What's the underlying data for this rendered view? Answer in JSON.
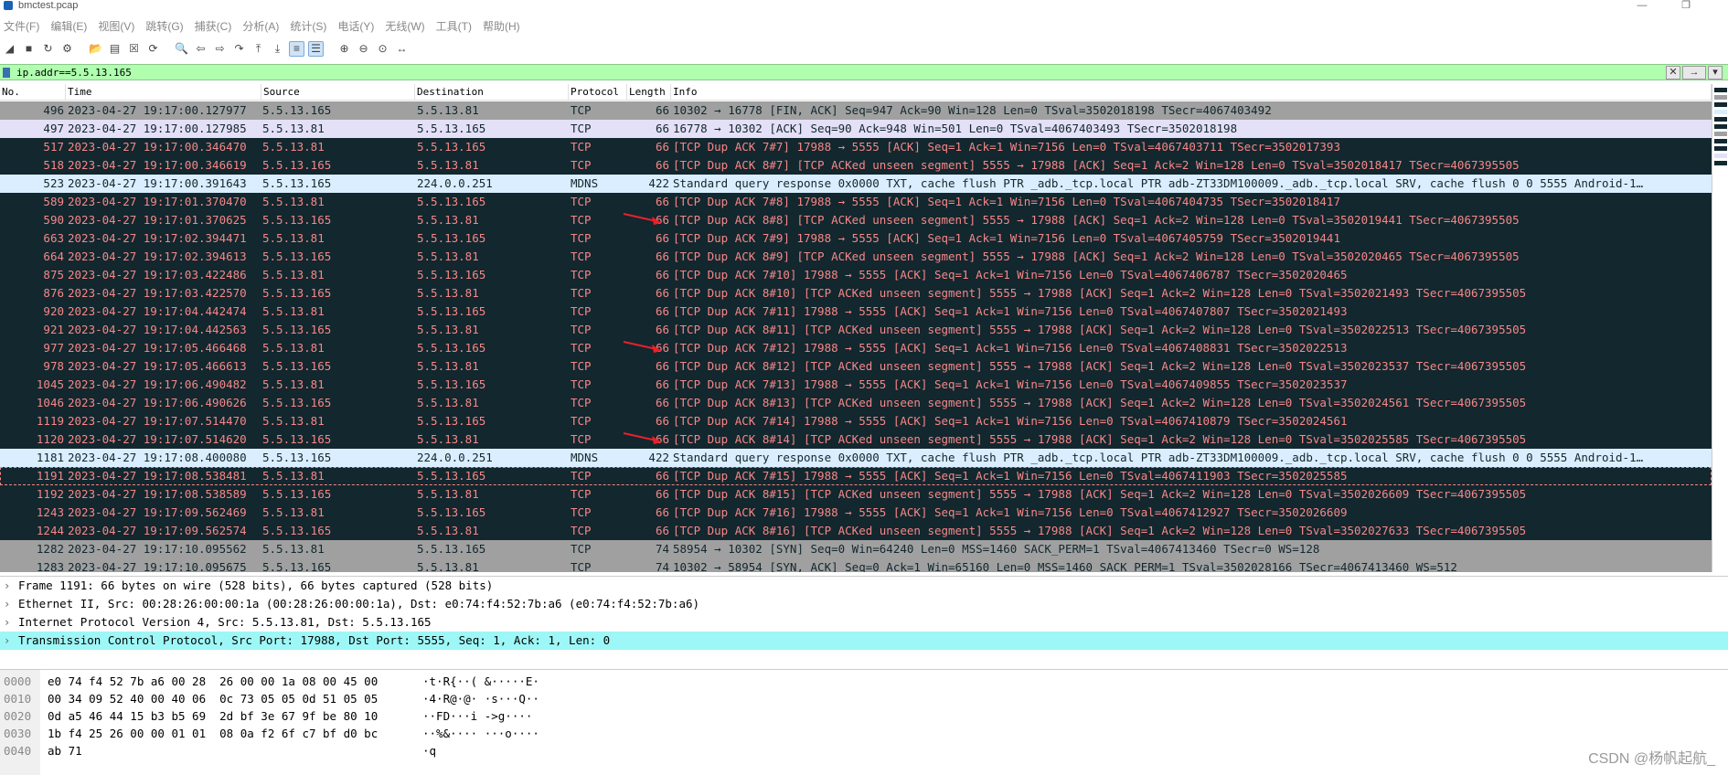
{
  "window": {
    "title": "bmctest.pcap",
    "minimize": "—",
    "restore": "❐"
  },
  "menu": [
    "文件(F)",
    "编辑(E)",
    "视图(V)",
    "跳转(G)",
    "捕获(C)",
    "分析(A)",
    "统计(S)",
    "电话(Y)",
    "无线(W)",
    "工具(T)",
    "帮助(H)"
  ],
  "toolbar_icons": [
    {
      "name": "shark-fin-start-icon",
      "glyph": "◢"
    },
    {
      "name": "stop-capture-icon",
      "glyph": "■"
    },
    {
      "name": "restart-capture-icon",
      "glyph": "↻"
    },
    {
      "name": "capture-options-icon",
      "glyph": "⚙"
    },
    {
      "name": "sep",
      "glyph": ""
    },
    {
      "name": "open-file-icon",
      "glyph": "📂"
    },
    {
      "name": "save-file-icon",
      "glyph": "▤"
    },
    {
      "name": "close-file-icon",
      "glyph": "☒"
    },
    {
      "name": "reload-file-icon",
      "glyph": "⟳"
    },
    {
      "name": "sep",
      "glyph": ""
    },
    {
      "name": "find-packet-icon",
      "glyph": "🔍"
    },
    {
      "name": "go-back-icon",
      "glyph": "⇦"
    },
    {
      "name": "go-forward-icon",
      "glyph": "⇨"
    },
    {
      "name": "go-to-packet-icon",
      "glyph": "↷"
    },
    {
      "name": "go-first-icon",
      "glyph": "⤒"
    },
    {
      "name": "go-last-icon",
      "glyph": "⤓"
    },
    {
      "name": "auto-scroll-icon",
      "glyph": "≡"
    },
    {
      "name": "colorize-icon",
      "glyph": "☰"
    },
    {
      "name": "sep",
      "glyph": ""
    },
    {
      "name": "zoom-in-icon",
      "glyph": "⊕"
    },
    {
      "name": "zoom-out-icon",
      "glyph": "⊖"
    },
    {
      "name": "normal-size-icon",
      "glyph": "⊙"
    },
    {
      "name": "resize-columns-icon",
      "glyph": "↔"
    }
  ],
  "filter": {
    "value": "ip.addr==5.5.13.165",
    "clear_label": "✕",
    "apply_label": "→",
    "dropdown_label": "▾"
  },
  "columns": [
    "No.",
    "Time",
    "Source",
    "Destination",
    "Protocol",
    "Length",
    "Info"
  ],
  "packets": [
    {
      "no": "496",
      "time": "2023-04-27 19:17:00.127977",
      "src": "5.5.13.165",
      "dst": "5.5.13.81",
      "proto": "TCP",
      "len": "66",
      "info": "10302 → 16778 [FIN, ACK] Seq=947 Ack=90 Win=128 Len=0 TSval=3502018198 TSecr=4067403492",
      "style": "gray"
    },
    {
      "no": "497",
      "time": "2023-04-27 19:17:00.127985",
      "src": "5.5.13.81",
      "dst": "5.5.13.165",
      "proto": "TCP",
      "len": "66",
      "info": "16778 → 10302 [ACK] Seq=90 Ack=948 Win=501 Len=0 TSval=4067403493 TSecr=3502018198",
      "style": "lav"
    },
    {
      "no": "517",
      "time": "2023-04-27 19:17:00.346470",
      "src": "5.5.13.81",
      "dst": "5.5.13.165",
      "proto": "TCP",
      "len": "66",
      "info": "[TCP Dup ACK 7#7] 17988 → 5555 [ACK] Seq=1 Ack=1 Win=7156 Len=0 TSval=4067403711 TSecr=3502017393",
      "style": "dark"
    },
    {
      "no": "518",
      "time": "2023-04-27 19:17:00.346619",
      "src": "5.5.13.165",
      "dst": "5.5.13.81",
      "proto": "TCP",
      "len": "66",
      "info": "[TCP Dup ACK 8#7] [TCP ACKed unseen segment] 5555 → 17988 [ACK] Seq=1 Ack=2 Win=128 Len=0 TSval=3502018417 TSecr=4067395505",
      "style": "dark"
    },
    {
      "no": "523",
      "time": "2023-04-27 19:17:00.391643",
      "src": "5.5.13.165",
      "dst": "224.0.0.251",
      "proto": "MDNS",
      "len": "422",
      "info": "Standard query response 0x0000 TXT, cache flush PTR _adb._tcp.local PTR adb-ZT33DM100009._adb._tcp.local SRV, cache flush 0 0 5555 Android-1…",
      "style": "light"
    },
    {
      "no": "589",
      "time": "2023-04-27 19:17:01.370470",
      "src": "5.5.13.81",
      "dst": "5.5.13.165",
      "proto": "TCP",
      "len": "66",
      "info": "[TCP Dup ACK 7#8] 17988 → 5555 [ACK] Seq=1 Ack=1 Win=7156 Len=0 TSval=4067404735 TSecr=3502018417",
      "style": "dark"
    },
    {
      "no": "590",
      "time": "2023-04-27 19:17:01.370625",
      "src": "5.5.13.165",
      "dst": "5.5.13.81",
      "proto": "TCP",
      "len": "66",
      "info": "[TCP Dup ACK 8#8] [TCP ACKed unseen segment] 5555 → 17988 [ACK] Seq=1 Ack=2 Win=128 Len=0 TSval=3502019441 TSecr=4067395505",
      "style": "dark"
    },
    {
      "no": "663",
      "time": "2023-04-27 19:17:02.394471",
      "src": "5.5.13.81",
      "dst": "5.5.13.165",
      "proto": "TCP",
      "len": "66",
      "info": "[TCP Dup ACK 7#9] 17988 → 5555 [ACK] Seq=1 Ack=1 Win=7156 Len=0 TSval=4067405759 TSecr=3502019441",
      "style": "dark"
    },
    {
      "no": "664",
      "time": "2023-04-27 19:17:02.394613",
      "src": "5.5.13.165",
      "dst": "5.5.13.81",
      "proto": "TCP",
      "len": "66",
      "info": "[TCP Dup ACK 8#9] [TCP ACKed unseen segment] 5555 → 17988 [ACK] Seq=1 Ack=2 Win=128 Len=0 TSval=3502020465 TSecr=4067395505",
      "style": "dark"
    },
    {
      "no": "875",
      "time": "2023-04-27 19:17:03.422486",
      "src": "5.5.13.81",
      "dst": "5.5.13.165",
      "proto": "TCP",
      "len": "66",
      "info": "[TCP Dup ACK 7#10] 17988 → 5555 [ACK] Seq=1 Ack=1 Win=7156 Len=0 TSval=4067406787 TSecr=3502020465",
      "style": "dark"
    },
    {
      "no": "876",
      "time": "2023-04-27 19:17:03.422570",
      "src": "5.5.13.165",
      "dst": "5.5.13.81",
      "proto": "TCP",
      "len": "66",
      "info": "[TCP Dup ACK 8#10] [TCP ACKed unseen segment] 5555 → 17988 [ACK] Seq=1 Ack=2 Win=128 Len=0 TSval=3502021493 TSecr=4067395505",
      "style": "dark"
    },
    {
      "no": "920",
      "time": "2023-04-27 19:17:04.442474",
      "src": "5.5.13.81",
      "dst": "5.5.13.165",
      "proto": "TCP",
      "len": "66",
      "info": "[TCP Dup ACK 7#11] 17988 → 5555 [ACK] Seq=1 Ack=1 Win=7156 Len=0 TSval=4067407807 TSecr=3502021493",
      "style": "dark"
    },
    {
      "no": "921",
      "time": "2023-04-27 19:17:04.442563",
      "src": "5.5.13.165",
      "dst": "5.5.13.81",
      "proto": "TCP",
      "len": "66",
      "info": "[TCP Dup ACK 8#11] [TCP ACKed unseen segment] 5555 → 17988 [ACK] Seq=1 Ack=2 Win=128 Len=0 TSval=3502022513 TSecr=4067395505",
      "style": "dark"
    },
    {
      "no": "977",
      "time": "2023-04-27 19:17:05.466468",
      "src": "5.5.13.81",
      "dst": "5.5.13.165",
      "proto": "TCP",
      "len": "66",
      "info": "[TCP Dup ACK 7#12] 17988 → 5555 [ACK] Seq=1 Ack=1 Win=7156 Len=0 TSval=4067408831 TSecr=3502022513",
      "style": "dark"
    },
    {
      "no": "978",
      "time": "2023-04-27 19:17:05.466613",
      "src": "5.5.13.165",
      "dst": "5.5.13.81",
      "proto": "TCP",
      "len": "66",
      "info": "[TCP Dup ACK 8#12] [TCP ACKed unseen segment] 5555 → 17988 [ACK] Seq=1 Ack=2 Win=128 Len=0 TSval=3502023537 TSecr=4067395505",
      "style": "dark"
    },
    {
      "no": "1045",
      "time": "2023-04-27 19:17:06.490482",
      "src": "5.5.13.81",
      "dst": "5.5.13.165",
      "proto": "TCP",
      "len": "66",
      "info": "[TCP Dup ACK 7#13] 17988 → 5555 [ACK] Seq=1 Ack=1 Win=7156 Len=0 TSval=4067409855 TSecr=3502023537",
      "style": "dark"
    },
    {
      "no": "1046",
      "time": "2023-04-27 19:17:06.490626",
      "src": "5.5.13.165",
      "dst": "5.5.13.81",
      "proto": "TCP",
      "len": "66",
      "info": "[TCP Dup ACK 8#13] [TCP ACKed unseen segment] 5555 → 17988 [ACK] Seq=1 Ack=2 Win=128 Len=0 TSval=3502024561 TSecr=4067395505",
      "style": "dark"
    },
    {
      "no": "1119",
      "time": "2023-04-27 19:17:07.514470",
      "src": "5.5.13.81",
      "dst": "5.5.13.165",
      "proto": "TCP",
      "len": "66",
      "info": "[TCP Dup ACK 7#14] 17988 → 5555 [ACK] Seq=1 Ack=1 Win=7156 Len=0 TSval=4067410879 TSecr=3502024561",
      "style": "dark"
    },
    {
      "no": "1120",
      "time": "2023-04-27 19:17:07.514620",
      "src": "5.5.13.165",
      "dst": "5.5.13.81",
      "proto": "TCP",
      "len": "66",
      "info": "[TCP Dup ACK 8#14] [TCP ACKed unseen segment] 5555 → 17988 [ACK] Seq=1 Ack=2 Win=128 Len=0 TSval=3502025585 TSecr=4067395505",
      "style": "dark"
    },
    {
      "no": "1181",
      "time": "2023-04-27 19:17:08.400080",
      "src": "5.5.13.165",
      "dst": "224.0.0.251",
      "proto": "MDNS",
      "len": "422",
      "info": "Standard query response 0x0000 TXT, cache flush PTR _adb._tcp.local PTR adb-ZT33DM100009._adb._tcp.local SRV, cache flush 0 0 5555 Android-1…",
      "style": "light"
    },
    {
      "no": "1191",
      "time": "2023-04-27 19:17:08.538481",
      "src": "5.5.13.81",
      "dst": "5.5.13.165",
      "proto": "TCP",
      "len": "66",
      "info": "[TCP Dup ACK 7#15] 17988 → 5555 [ACK] Seq=1 Ack=1 Win=7156 Len=0 TSval=4067411903 TSecr=3502025585",
      "style": "dark",
      "selected": true
    },
    {
      "no": "1192",
      "time": "2023-04-27 19:17:08.538589",
      "src": "5.5.13.165",
      "dst": "5.5.13.81",
      "proto": "TCP",
      "len": "66",
      "info": "[TCP Dup ACK 8#15] [TCP ACKed unseen segment] 5555 → 17988 [ACK] Seq=1 Ack=2 Win=128 Len=0 TSval=3502026609 TSecr=4067395505",
      "style": "dark"
    },
    {
      "no": "1243",
      "time": "2023-04-27 19:17:09.562469",
      "src": "5.5.13.81",
      "dst": "5.5.13.165",
      "proto": "TCP",
      "len": "66",
      "info": "[TCP Dup ACK 7#16] 17988 → 5555 [ACK] Seq=1 Ack=1 Win=7156 Len=0 TSval=4067412927 TSecr=3502026609",
      "style": "dark"
    },
    {
      "no": "1244",
      "time": "2023-04-27 19:17:09.562574",
      "src": "5.5.13.165",
      "dst": "5.5.13.81",
      "proto": "TCP",
      "len": "66",
      "info": "[TCP Dup ACK 8#16] [TCP ACKed unseen segment] 5555 → 17988 [ACK] Seq=1 Ack=2 Win=128 Len=0 TSval=3502027633 TSecr=4067395505",
      "style": "dark"
    },
    {
      "no": "1282",
      "time": "2023-04-27 19:17:10.095562",
      "src": "5.5.13.81",
      "dst": "5.5.13.165",
      "proto": "TCP",
      "len": "74",
      "info": "58954 → 10302 [SYN] Seq=0 Win=64240 Len=0 MSS=1460 SACK_PERM=1 TSval=4067413460 TSecr=0 WS=128",
      "style": "gray"
    },
    {
      "no": "1283",
      "time": "2023-04-27 19:17:10.095675",
      "src": "5.5.13.165",
      "dst": "5.5.13.81",
      "proto": "TCP",
      "len": "74",
      "info": "10302 → 58954 [SYN, ACK] Seq=0 Ack=1 Win=65160 Len=0 MSS=1460 SACK_PERM=1 TSval=3502028166 TSecr=4067413460 WS=512",
      "style": "gray"
    }
  ],
  "details": [
    {
      "text": "Frame 1191: 66 bytes on wire (528 bits), 66 bytes captured (528 bits)",
      "selected": false
    },
    {
      "text": "Ethernet II, Src: 00:28:26:00:00:1a (00:28:26:00:00:1a), Dst: e0:74:f4:52:7b:a6 (e0:74:f4:52:7b:a6)",
      "selected": false
    },
    {
      "text": "Internet Protocol Version 4, Src: 5.5.13.81, Dst: 5.5.13.165",
      "selected": false
    },
    {
      "text": "Transmission Control Protocol, Src Port: 17988, Dst Port: 5555, Seq: 1, Ack: 1, Len: 0",
      "selected": true
    }
  ],
  "bytes": [
    {
      "off": "0000",
      "hex": "e0 74 f4 52 7b a6 00 28  26 00 00 1a 08 00 45 00",
      "asc": "·t·R{··( &·····E·"
    },
    {
      "off": "0010",
      "hex": "00 34 09 52 40 00 40 06  0c 73 05 05 0d 51 05 05",
      "asc": "·4·R@·@· ·s···Q··"
    },
    {
      "off": "0020",
      "hex": "0d a5 46 44 15 b3 b5 69  2d bf 3e 67 9f be 80 10",
      "asc": "··FD···i ->g····"
    },
    {
      "off": "0030",
      "hex": "1b f4 25 26 00 00 01 01  08 0a f2 6f c7 bf d0 bc",
      "asc": "··%&···· ···o····"
    },
    {
      "off": "0040",
      "hex": "ab 71",
      "asc": "·q"
    }
  ],
  "watermark": "CSDN @杨帆起航_",
  "colors": {
    "dark_bg": "#12272e",
    "dark_fg": "#f78787",
    "gray_bg": "#a0a0a0",
    "light_bg": "#daeeff",
    "lav_bg": "#e4e0f7",
    "filter_bg": "#afffaf",
    "selected_detail_bg": "#9ef7f7",
    "arrow": "#e8212a"
  },
  "arrow_markers": [
    "590",
    "977",
    "1120"
  ]
}
